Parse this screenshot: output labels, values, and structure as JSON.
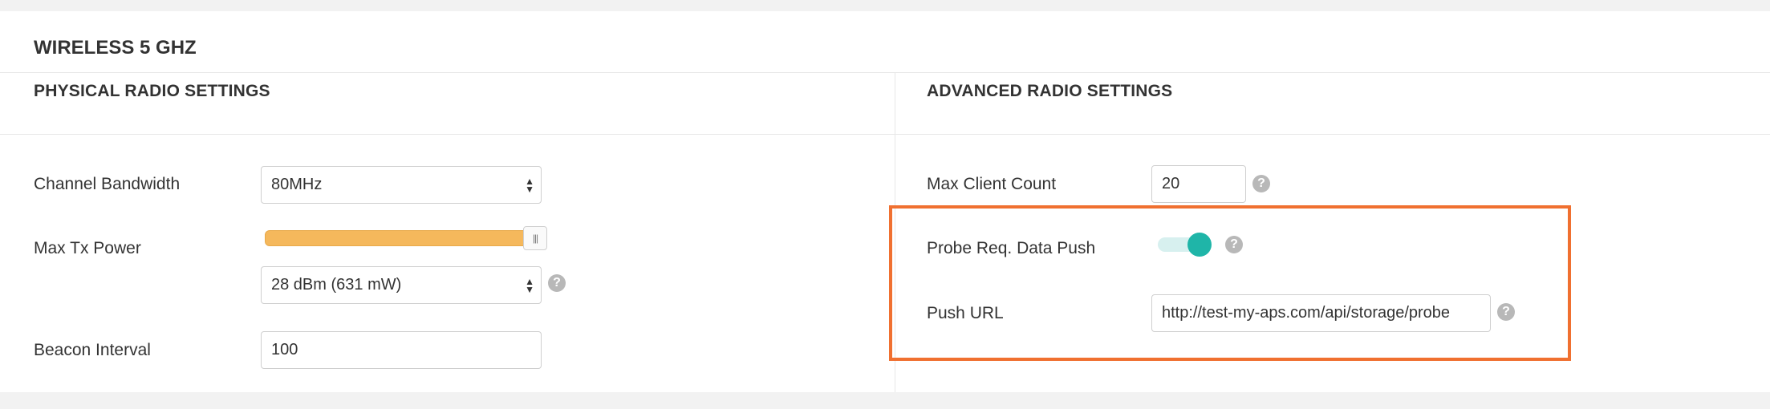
{
  "panel": {
    "title": "WIRELESS 5 GHZ"
  },
  "physical": {
    "title": "PHYSICAL RADIO SETTINGS",
    "channel_bandwidth": {
      "label": "Channel Bandwidth",
      "value": "80MHz"
    },
    "max_tx_power": {
      "label": "Max Tx Power",
      "slider_level": 1.0,
      "slider_color": "#f5b85c",
      "value": "28 dBm (631 mW)"
    },
    "beacon_interval": {
      "label": "Beacon Interval",
      "value": "100"
    }
  },
  "advanced": {
    "title": "ADVANCED RADIO SETTINGS",
    "max_client_count": {
      "label": "Max Client Count",
      "value": "20"
    },
    "probe_req_push": {
      "label": "Probe Req. Data Push",
      "enabled": true,
      "toggle_color": "#1fb5a8"
    },
    "push_url": {
      "label": "Push URL",
      "value": "http://test-my-aps.com/api/storage/probe"
    }
  },
  "help_glyph": "?",
  "highlight_color": "#f07030",
  "icons": [
    "select-arrows-icon",
    "help-icon",
    "slider-grip-icon"
  ]
}
